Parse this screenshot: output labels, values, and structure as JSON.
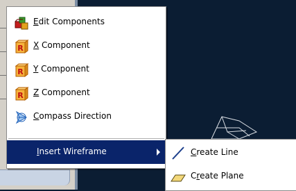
{
  "menu": {
    "items": [
      {
        "mnemonic": "E",
        "rest": "dit Components",
        "icon": "edit-components-icon"
      },
      {
        "mnemonic": "X",
        "rest": " Component",
        "icon": "x-component-icon"
      },
      {
        "mnemonic": "Y",
        "rest": " Component",
        "icon": "y-component-icon"
      },
      {
        "mnemonic": "Z",
        "rest": " Component",
        "icon": "z-component-icon"
      },
      {
        "mnemonic": "C",
        "rest": "ompass Direction",
        "icon": "compass-direction-icon"
      },
      {
        "mnemonic": "I",
        "rest": "nsert Wireframe",
        "icon": "submenu-arrow-icon"
      }
    ]
  },
  "submenu": {
    "items": [
      {
        "mnemonic": "C",
        "rest": "reate Line",
        "icon": "line-icon"
      },
      {
        "pre": "C",
        "mnemonic": "r",
        "rest": "eate Plane",
        "icon": "plane-icon"
      }
    ]
  },
  "icons": {
    "component_letter": "R",
    "component_fill": "#f6b33c",
    "component_border": "#b35e00",
    "highlight": "#0a246a"
  }
}
